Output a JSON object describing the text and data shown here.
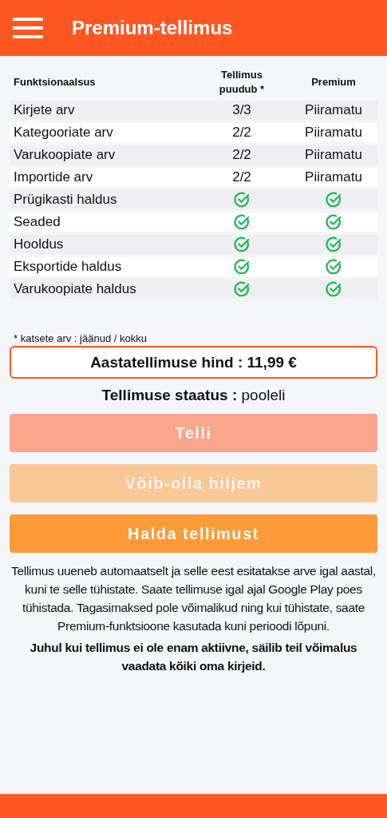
{
  "app_bar": {
    "title": "Premium-tellimus"
  },
  "table": {
    "columns": [
      "Funktsionaalsus",
      "Tellimus puudub *",
      "Premium"
    ],
    "rows": [
      [
        {
          "kind": "text",
          "text": "Kirjete arv"
        },
        {
          "kind": "text",
          "text": "3/3"
        },
        {
          "kind": "text",
          "text": "Piiramatu"
        }
      ],
      [
        {
          "kind": "text",
          "text": "Kategooriate arv"
        },
        {
          "kind": "text",
          "text": "2/2"
        },
        {
          "kind": "text",
          "text": "Piiramatu"
        }
      ],
      [
        {
          "kind": "text",
          "text": "Varukoopiate arv"
        },
        {
          "kind": "text",
          "text": "2/2"
        },
        {
          "kind": "text",
          "text": "Piiramatu"
        }
      ],
      [
        {
          "kind": "text",
          "text": "Importide arv"
        },
        {
          "kind": "text",
          "text": "2/2"
        },
        {
          "kind": "text",
          "text": "Piiramatu"
        }
      ],
      [
        {
          "kind": "text",
          "text": "Prügikasti haldus"
        },
        {
          "kind": "check"
        },
        {
          "kind": "check"
        }
      ],
      [
        {
          "kind": "text",
          "text": "Seaded"
        },
        {
          "kind": "check"
        },
        {
          "kind": "check"
        }
      ],
      [
        {
          "kind": "text",
          "text": "Hooldus"
        },
        {
          "kind": "check"
        },
        {
          "kind": "check"
        }
      ],
      [
        {
          "kind": "text",
          "text": "Eksportide haldus"
        },
        {
          "kind": "check"
        },
        {
          "kind": "check"
        }
      ],
      [
        {
          "kind": "text",
          "text": "Varukoopiate haldus"
        },
        {
          "kind": "check"
        },
        {
          "kind": "check"
        }
      ]
    ]
  },
  "footnote": "* katsete arv : jäänud / kokku",
  "price": "Aastatellimuse hind : 11,99 €",
  "status": "**Tellimuse staatus :** pooleli",
  "buttons": [
    {
      "label": "Telli",
      "color": "#f9a68c",
      "disabled": true
    },
    {
      "label": "Võib-olla hiljem",
      "color": "#f9c897",
      "disabled": true
    },
    {
      "label": "Halda tellimust",
      "color": "#fe9a37",
      "disabled": false
    }
  ],
  "notes": [
    "Tellimus uueneb automaatselt ja selle eest esitatakse arve igal aastal, kuni te selle tühistate. Saate tellimuse igal ajal Google Play poes tühistada. Tagasimaksed pole võimalikud ning kui tühistate, saate Premium-funktsioone kasutada kuni perioodi lõpuni.",
    "Juhul kui tellimus ei ole enam aktiivne, säilib teil võimalus vaadata kõiki oma kirjeid."
  ]
}
